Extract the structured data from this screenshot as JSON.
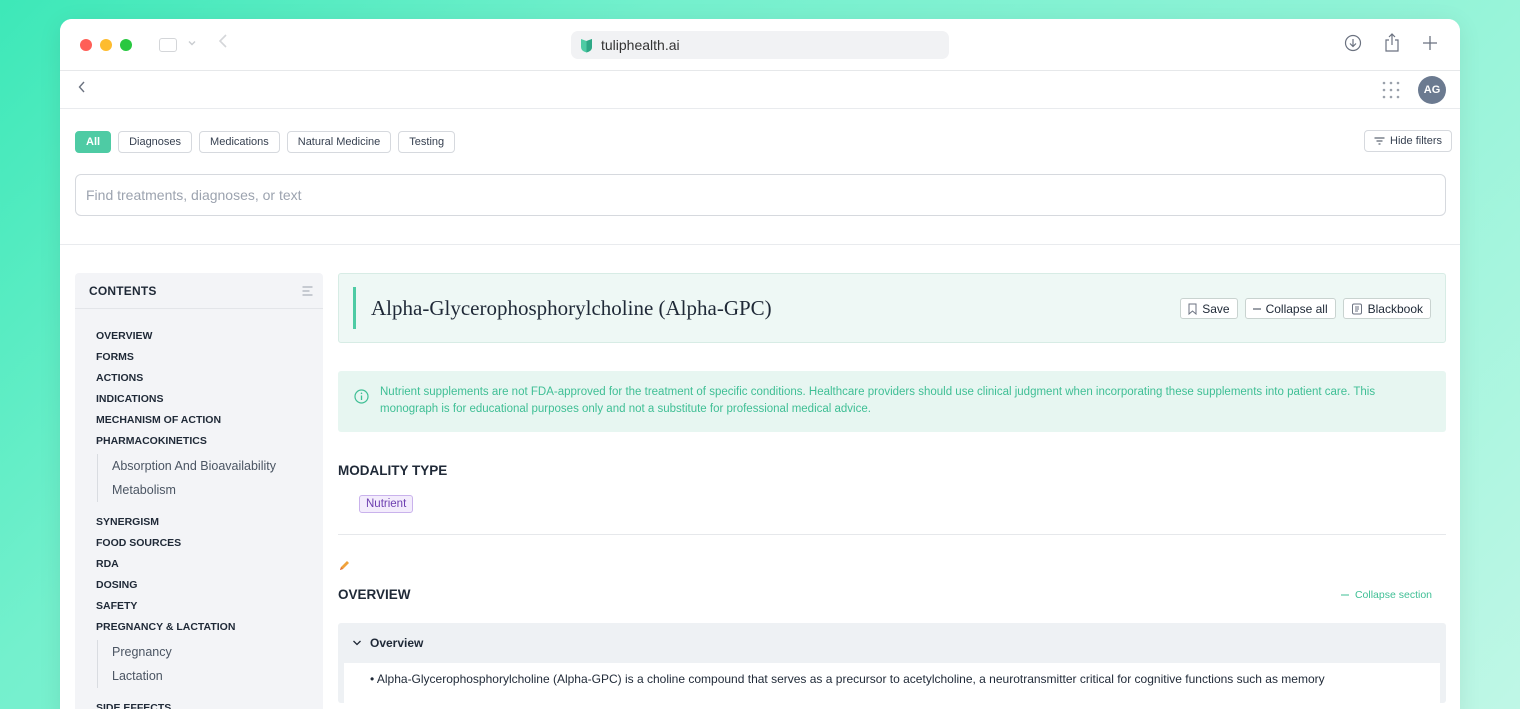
{
  "browser": {
    "url": "tuliphealth.ai"
  },
  "appbar": {
    "avatar_initials": "AG"
  },
  "filters": {
    "chips": [
      "All",
      "Diagnoses",
      "Medications",
      "Natural Medicine",
      "Testing"
    ],
    "active": "All",
    "hide_label": "Hide filters"
  },
  "search": {
    "placeholder": "Find treatments, diagnoses, or text"
  },
  "contents": {
    "title": "CONTENTS",
    "items": [
      {
        "label": "OVERVIEW"
      },
      {
        "label": "FORMS"
      },
      {
        "label": "ACTIONS"
      },
      {
        "label": "INDICATIONS"
      },
      {
        "label": "MECHANISM OF ACTION"
      },
      {
        "label": "PHARMACOKINETICS",
        "children": [
          "Absorption And Bioavailability",
          "Metabolism"
        ]
      },
      {
        "label": "SYNERGISM"
      },
      {
        "label": "FOOD SOURCES"
      },
      {
        "label": "RDA"
      },
      {
        "label": "DOSING"
      },
      {
        "label": "SAFETY"
      },
      {
        "label": "PREGNANCY & LACTATION",
        "children": [
          "Pregnancy",
          "Lactation"
        ]
      },
      {
        "label": "SIDE EFFECTS"
      }
    ]
  },
  "monograph": {
    "title": "Alpha-Glycerophosphorylcholine (Alpha-GPC)",
    "actions": {
      "save": "Save",
      "collapse_all": "Collapse all",
      "blackbook": "Blackbook"
    },
    "disclaimer": "Nutrient supplements are not FDA-approved for the treatment of specific conditions. Healthcare providers should use clinical judgment when incorporating these supplements into patient care. This monograph is for educational purposes only and not a substitute for professional medical advice.",
    "modality_heading": "MODALITY TYPE",
    "modality_badge": "Nutrient",
    "overview_heading": "OVERVIEW",
    "collapse_section": "Collapse section",
    "overview_accordion_title": "Overview",
    "overview_text": "• Alpha-Glycerophosphorylcholine (Alpha-GPC) is a choline compound that serves as a precursor to acetylcholine, a neurotransmitter critical for cognitive functions such as memory"
  },
  "colors": {
    "accent": "#4ecba4",
    "info_text": "#3fbf95",
    "badge_purple": "#6d3fb0"
  }
}
